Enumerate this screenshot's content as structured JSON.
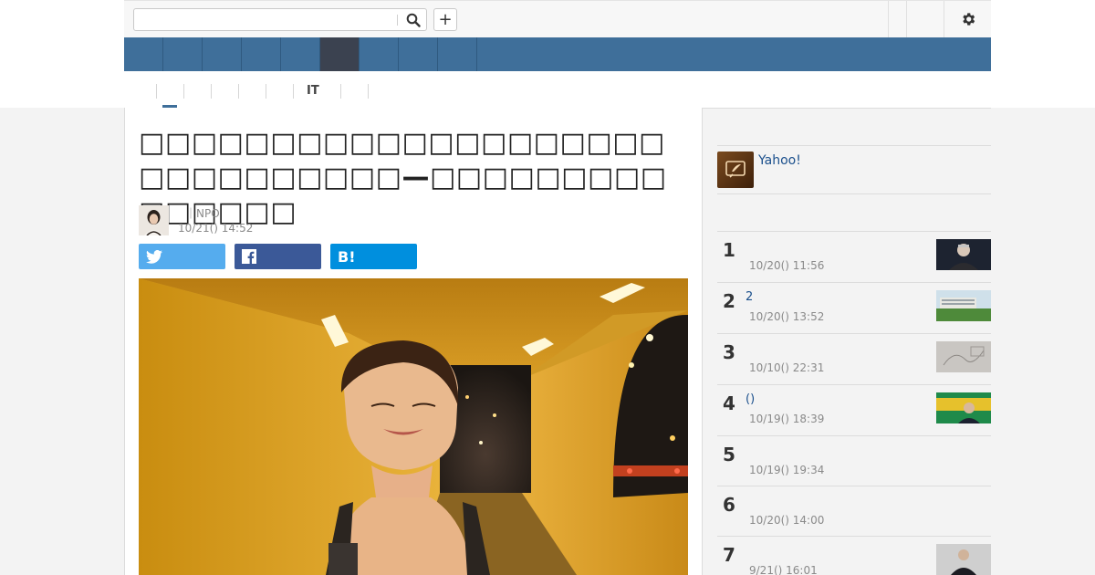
{
  "search": {
    "placeholder": ""
  },
  "header": {
    "add_label": "+"
  },
  "nav": {
    "items": [
      "",
      "",
      "",
      "",
      "",
      "",
      "",
      "",
      ""
    ],
    "active_index": 5
  },
  "categories": [
    "",
    "",
    "",
    "",
    "",
    "IT",
    "",
    ""
  ],
  "article": {
    "title": "□□□□□□□□□□□□□□□□□□□□□□□□□□□□□□—□□□□□□□□□□□□□□□",
    "author_org": "｜NPO",
    "timestamp": "10/21() 14:52",
    "share": {
      "hatena_label": "B!"
    }
  },
  "sidebar": {
    "promo_text": "Yahoo!",
    "ranking": [
      {
        "rank": "1",
        "title": "",
        "date": "10/20() 11:56",
        "has_thumb": true
      },
      {
        "rank": "2",
        "title": "2",
        "date": "10/20() 13:52",
        "has_thumb": true
      },
      {
        "rank": "3",
        "title": "",
        "date": "10/10() 22:31",
        "has_thumb": true
      },
      {
        "rank": "4",
        "title": " ()",
        "date": "10/19() 18:39",
        "has_thumb": true
      },
      {
        "rank": "5",
        "title": "",
        "date": "10/19() 19:34",
        "has_thumb": false
      },
      {
        "rank": "6",
        "title": "",
        "date": "10/20() 14:00",
        "has_thumb": false
      },
      {
        "rank": "7",
        "title": "",
        "date": "9/21() 16:01",
        "has_thumb": true
      }
    ]
  },
  "colors": {
    "nav_blue": "#3f6f9a",
    "nav_active": "#3b4250",
    "twitter": "#55acee",
    "facebook": "#3b5998",
    "hatena": "#008fde",
    "link": "#1a4f8c"
  }
}
